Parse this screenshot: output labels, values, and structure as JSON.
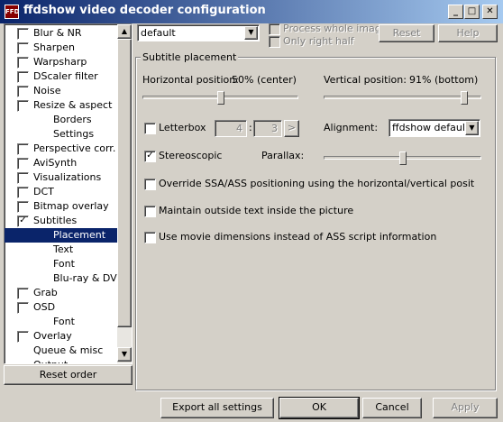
{
  "window": {
    "title": "ffdshow video decoder configuration",
    "icon_text": "FFD"
  },
  "titlebar_buttons": {
    "minimize": "_",
    "maximize": "□",
    "close": "✕"
  },
  "tree": {
    "items": [
      {
        "label": "Blur & NR",
        "checkbox": true,
        "checked": false
      },
      {
        "label": "Sharpen",
        "checkbox": true,
        "checked": false
      },
      {
        "label": "Warpsharp",
        "checkbox": true,
        "checked": false
      },
      {
        "label": "DScaler filter",
        "checkbox": true,
        "checked": false
      },
      {
        "label": "Noise",
        "checkbox": true,
        "checked": false
      },
      {
        "label": "Resize & aspect",
        "checkbox": true,
        "checked": false
      },
      {
        "label": "Borders",
        "checkbox": false,
        "child": true
      },
      {
        "label": "Settings",
        "checkbox": false,
        "child": true
      },
      {
        "label": "Perspective corr.",
        "checkbox": true,
        "checked": false
      },
      {
        "label": "AviSynth",
        "checkbox": true,
        "checked": false
      },
      {
        "label": "Visualizations",
        "checkbox": true,
        "checked": false
      },
      {
        "label": "DCT",
        "checkbox": true,
        "checked": false
      },
      {
        "label": "Bitmap overlay",
        "checkbox": true,
        "checked": false
      },
      {
        "label": "Subtitles",
        "checkbox": true,
        "checked": true
      },
      {
        "label": "Placement",
        "checkbox": false,
        "child": true,
        "selected": true
      },
      {
        "label": "Text",
        "checkbox": false,
        "child": true
      },
      {
        "label": "Font",
        "checkbox": false,
        "child": true
      },
      {
        "label": "Blu-ray & DVD",
        "checkbox": false,
        "child": true
      },
      {
        "label": "Grab",
        "checkbox": true,
        "checked": false
      },
      {
        "label": "OSD",
        "checkbox": true,
        "checked": false
      },
      {
        "label": "Font",
        "checkbox": false,
        "child": true
      },
      {
        "label": "Overlay",
        "checkbox": true,
        "checked": false
      },
      {
        "label": "Queue & misc",
        "checkbox": false,
        "plain": true
      },
      {
        "label": "Output",
        "checkbox": false,
        "plain": true
      }
    ],
    "check_glyph": "✓",
    "scroll_up": "▲",
    "scroll_down": "▼"
  },
  "reset_order_label": "Reset order",
  "top": {
    "preset_value": "default",
    "preset_arrow": "▼",
    "process_whole_image": "Process whole image",
    "only_right_half": "Only right half",
    "reset_label": "Reset",
    "help_label": "Help"
  },
  "group": {
    "title": "Subtitle placement",
    "horizontal_label": "Horizontal position:",
    "horizontal_value": "50% (center)",
    "horizontal_level": 0.5,
    "vertical_label": "Vertical position:",
    "vertical_value": "91% (bottom)",
    "vertical_level": 0.91,
    "letterbox_label": "Letterbox",
    "letterbox_a": "4",
    "letterbox_colon": ":",
    "letterbox_b": "3",
    "letterbox_btn": ">",
    "alignment_label": "Alignment:",
    "alignment_value": "ffdshow default",
    "alignment_arrow": "▼",
    "stereoscopic_label": "Stereoscopic",
    "stereoscopic_checked": true,
    "parallax_label": "Parallax:",
    "parallax_level": 0.5,
    "override_label": "Override SSA/ASS positioning using the horizontal/vertical position sliders",
    "maintain_label": "Maintain outside text inside the picture",
    "movie_dims_label": "Use movie dimensions instead of ASS script information"
  },
  "bottom": {
    "export_label": "Export all settings",
    "ok_label": "OK",
    "cancel_label": "Cancel",
    "apply_label": "Apply"
  }
}
